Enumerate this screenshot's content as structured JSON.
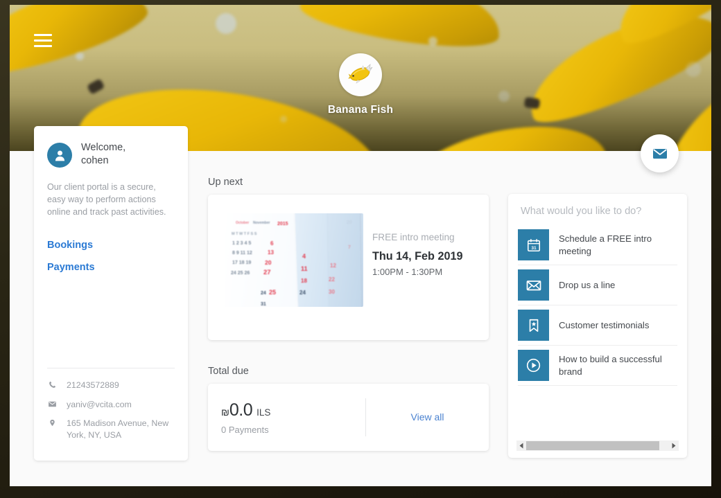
{
  "business": {
    "name": "Banana Fish",
    "logo_icon": "banana-fish-logo"
  },
  "header": {
    "menu_icon": "hamburger-menu-icon",
    "message_fab_icon": "envelope-icon"
  },
  "profile": {
    "avatar_icon": "user-avatar-icon",
    "welcome_line1": "Welcome,",
    "welcome_line2": "cohen",
    "description": "Our client portal is a secure, easy way to perform actions online and track past activities.",
    "links": [
      {
        "label": "Bookings",
        "name": "sidebar-link-bookings"
      },
      {
        "label": "Payments",
        "name": "sidebar-link-payments"
      }
    ],
    "contact": [
      {
        "icon": "phone-icon",
        "value": "21243572889"
      },
      {
        "icon": "envelope-icon",
        "value": "yaniv@vcita.com"
      },
      {
        "icon": "location-pin-icon",
        "value": "165 Madison Avenue, New York, NY, USA"
      }
    ]
  },
  "up_next": {
    "section_title": "Up next",
    "image_alt": "calendar-photo",
    "service": "FREE intro meeting",
    "date": "Thu 14, Feb 2019",
    "time": "1:00PM - 1:30PM"
  },
  "total_due": {
    "section_title": "Total due",
    "currency_symbol": "₪",
    "amount": "0.0",
    "currency_code": "ILS",
    "payments_count": "0 Payments",
    "view_all_label": "View all"
  },
  "actions": {
    "title": "What would you like to do?",
    "items": [
      {
        "icon": "calendar-31-icon",
        "label": "Schedule a FREE intro meeting"
      },
      {
        "icon": "envelope-icon",
        "label": "Drop us a line"
      },
      {
        "icon": "bookmark-star-icon",
        "label": "Customer testimonials"
      },
      {
        "icon": "play-circle-icon",
        "label": "How to build a successful brand"
      }
    ],
    "scrollbar": {
      "left_arrow_icon": "chevron-left-icon",
      "right_arrow_icon": "chevron-right-icon"
    }
  },
  "colors": {
    "accent_blue": "#2c7ea8",
    "link_blue": "#2b7ad4",
    "banner_khaki": "#c9bd80",
    "banana_yellow": "#e8b707"
  }
}
